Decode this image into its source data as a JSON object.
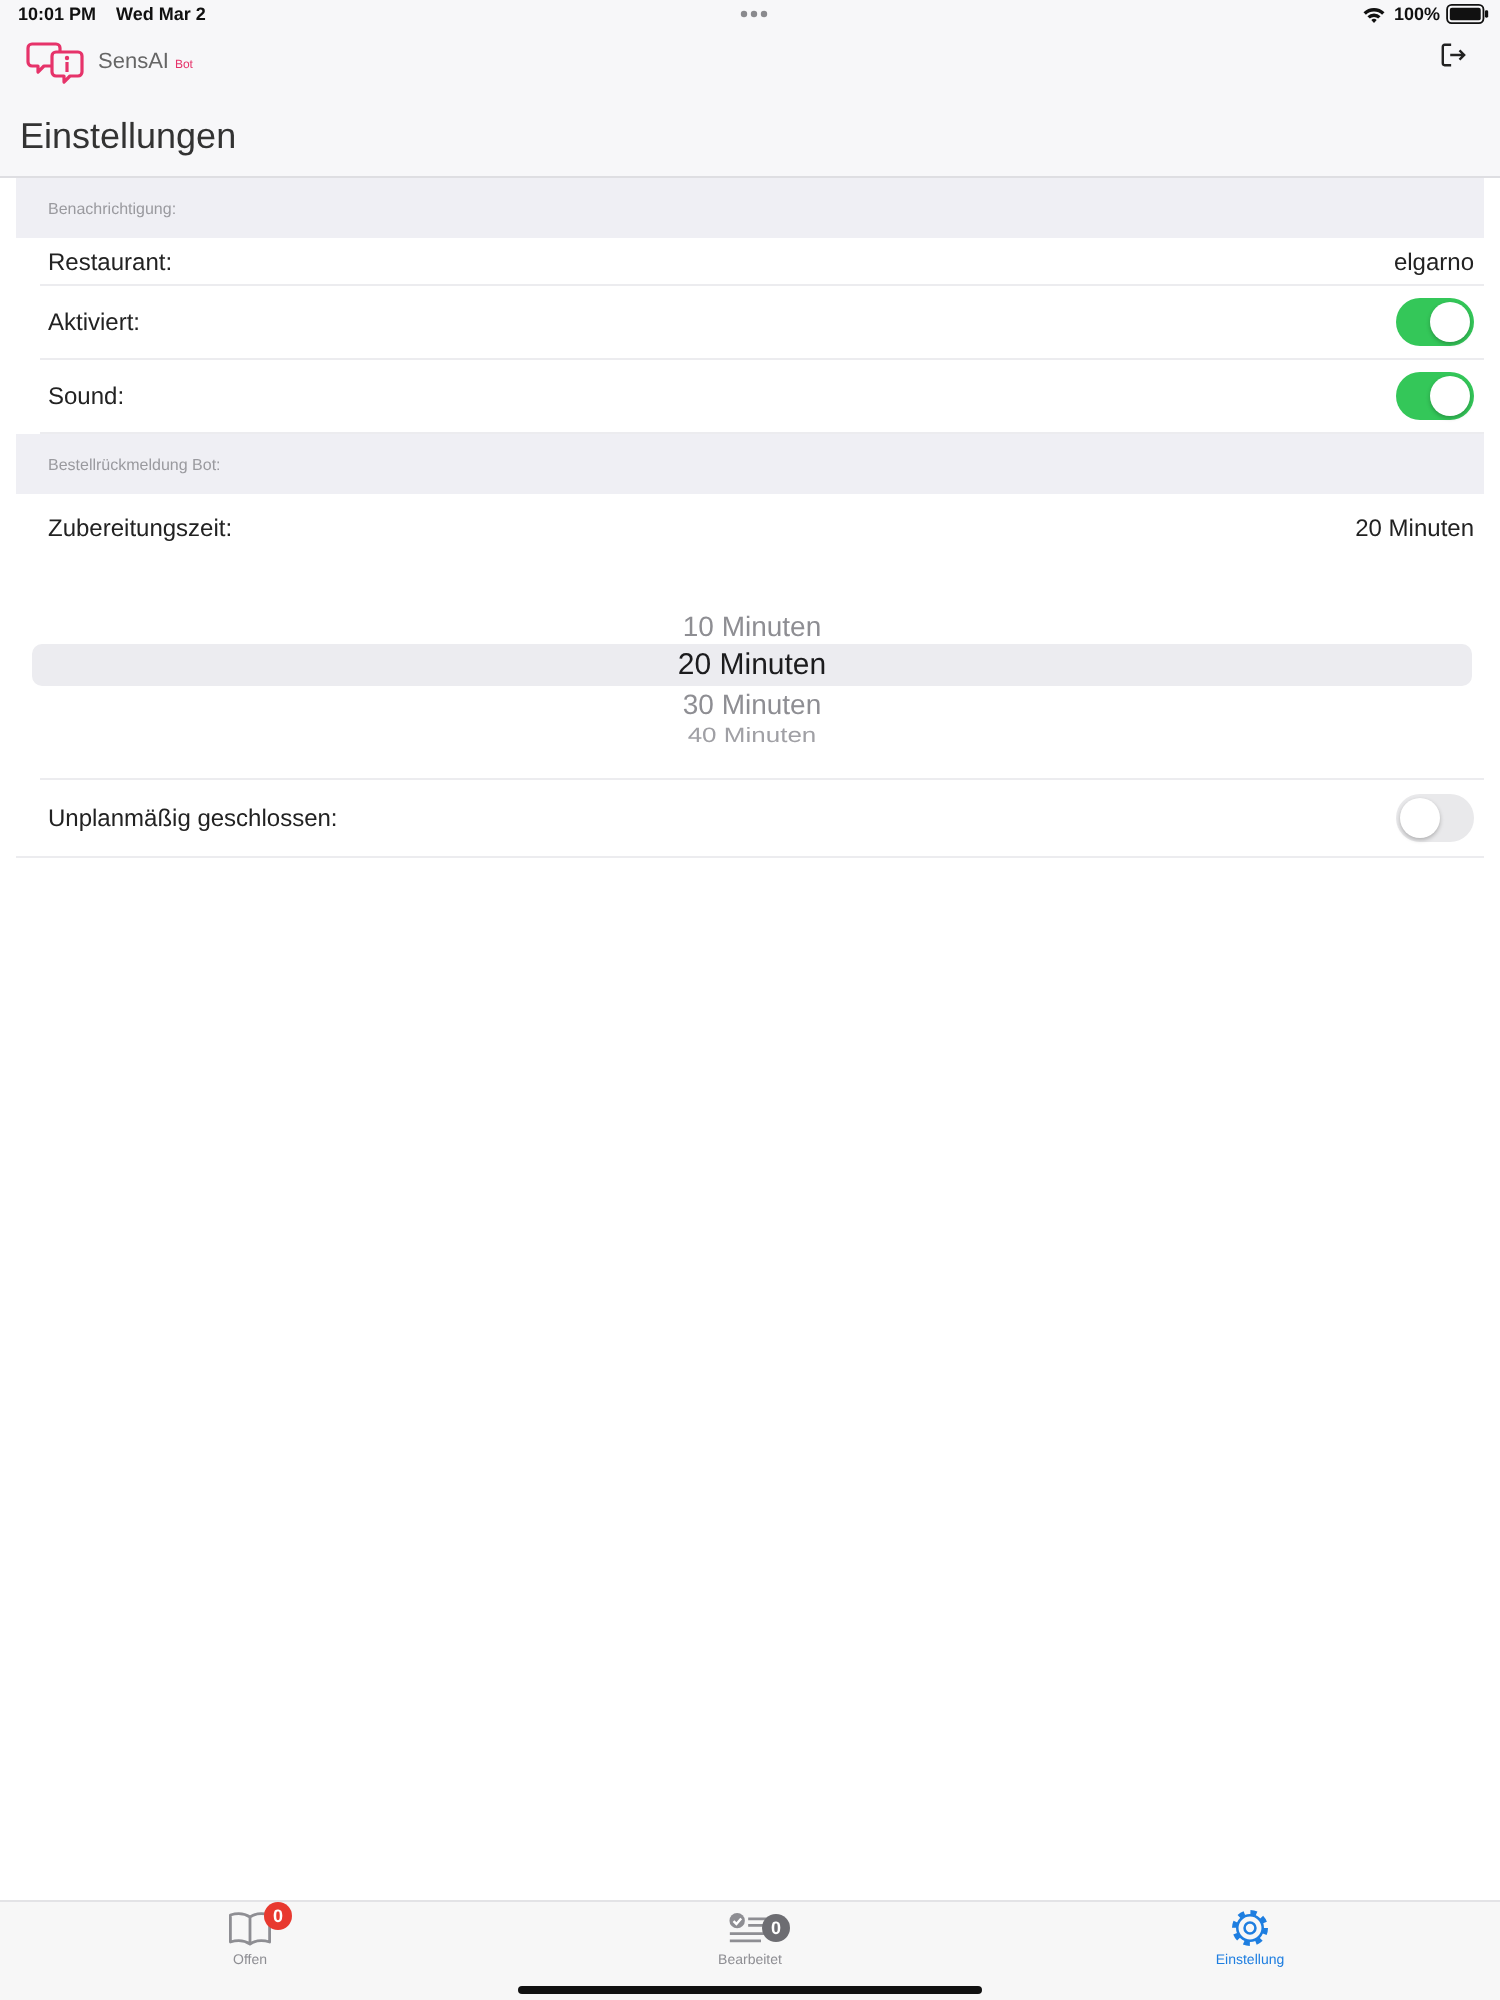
{
  "status_bar": {
    "time": "10:01 PM",
    "date": "Wed Mar 2",
    "battery": "100%"
  },
  "header": {
    "app_name": "SensAI",
    "app_tag": "Bot",
    "title": "Einstellungen"
  },
  "sections": [
    {
      "title": "Benachrichtigung:",
      "rows": [
        {
          "kind": "value",
          "label": "Restaurant:",
          "value": "elgarno"
        },
        {
          "kind": "toggle",
          "label": "Aktiviert:",
          "on": true
        },
        {
          "kind": "toggle",
          "label": "Sound:",
          "on": true
        }
      ]
    },
    {
      "title": "Bestellrückmeldung Bot:",
      "rows": [
        {
          "kind": "value",
          "label": "Zubereitungszeit:",
          "value": "20 Minuten"
        },
        {
          "kind": "picker",
          "options": [
            {
              "label": "10 Minuten",
              "selected": false
            },
            {
              "label": "20 Minuten",
              "selected": true
            },
            {
              "label": "30 Minuten",
              "selected": false
            },
            {
              "label": "40 Minuten",
              "selected": false
            }
          ]
        },
        {
          "kind": "toggle",
          "label": "Unplanmäßig geschlossen:",
          "on": false
        }
      ]
    }
  ],
  "tab_bar": [
    {
      "label": "Offen",
      "badge": {
        "text": "0",
        "color": "#e8392f"
      },
      "selected": false
    },
    {
      "label": "Bearbeitet",
      "badge": {
        "text": "0",
        "color": "#6d6d72"
      },
      "selected": false
    },
    {
      "label": "Einstellung",
      "selected": true
    }
  ]
}
